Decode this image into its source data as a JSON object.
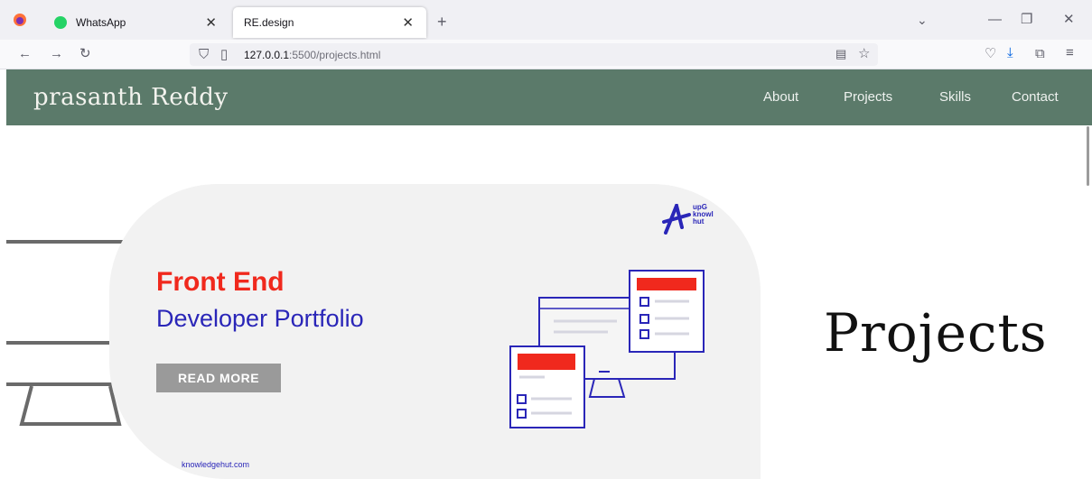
{
  "browser": {
    "tabs": [
      {
        "label": "WhatsApp",
        "active": false
      },
      {
        "label": "RE.design",
        "active": true
      }
    ],
    "url_host": "127.0.0.1",
    "url_path": ":5500/projects.html"
  },
  "site": {
    "brand": "prasanth Reddy",
    "nav": [
      "About",
      "Projects",
      "Skills",
      "Contact"
    ]
  },
  "banner": {
    "headline": "Front End",
    "subheadline": "Developer Portfolio",
    "cta": "READ MORE",
    "logo_lines": [
      "upG",
      "knowl",
      "hut"
    ],
    "footer_url": "knowledgehut.com"
  },
  "page": {
    "title": "Projects"
  },
  "colors": {
    "nav_bg": "#5b7a6a",
    "headline_red": "#f0291d",
    "subheadline_blue": "#2a26b8",
    "cta_bg": "#9a9a9a"
  }
}
